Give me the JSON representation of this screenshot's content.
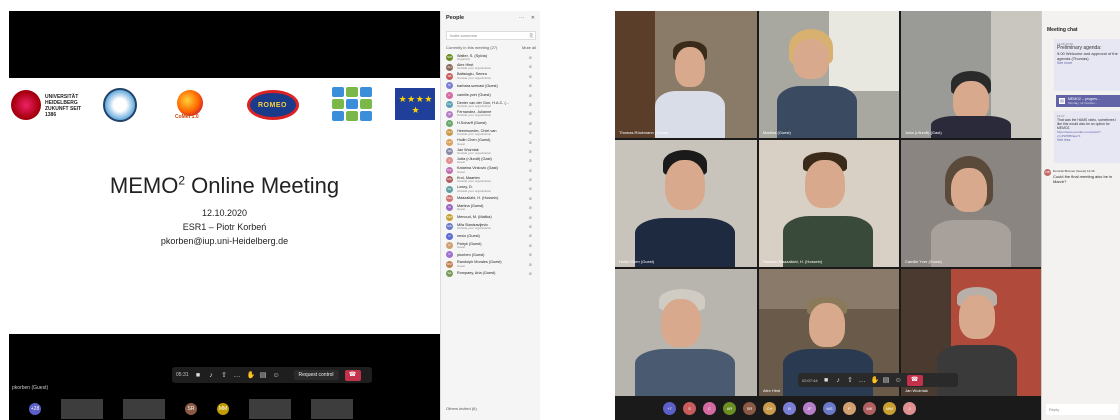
{
  "left": {
    "slide": {
      "uni_text": "UNIVERSITÄT HEIDELBERG ZUKUNFT SEIT 1386",
      "comet_text": "CoMet 1.0",
      "romeo_text": "ROMEO",
      "eu_stars": "★ ★ ★ ★ ★",
      "title_main": "MEMO",
      "title_sup": "2",
      "title_rest": " Online Meeting",
      "date": "12.10.2020",
      "presenter": "ESR1 – Piotr Korbeń",
      "email": "pkorben@iup.uni-Heidelberg.de"
    },
    "call": {
      "time": "05:31",
      "request_control": "Request control",
      "hangup_icon": "phone-hangup-icon"
    },
    "presenter_name": "pkorben (Guest)",
    "thumbs": [
      {
        "initials": "+28",
        "color": "#5b5fc7"
      },
      {
        "initials": "SR",
        "color": "#8a5a44"
      },
      {
        "initials": "MM",
        "color": "#c19c00"
      }
    ],
    "people": {
      "title": "People",
      "more": "···",
      "close": "✕",
      "invite_placeholder": "Invite someone",
      "section": "Currently in this meeting (27)",
      "mute_all": "Mute all",
      "others_invited": "Others invited (6)",
      "items": [
        {
          "initials": "SW",
          "name": "Walter, S. (Sylvia)",
          "sub": "Organizer",
          "color": "#6b8e23"
        },
        {
          "initials": "AH",
          "name": "Alex Hirst",
          "sub": "Outside your organization",
          "color": "#8b6c5c"
        },
        {
          "initials": "SB",
          "name": "Baltsioglu, Semra",
          "sub": "Outside your organization",
          "color": "#c85c5c"
        },
        {
          "initials": "B",
          "name": "barbara.szenasi (Guest)",
          "sub": "",
          "color": "#7a7fd6"
        },
        {
          "initials": "C",
          "name": "camille.yver (Guest)",
          "sub": "",
          "color": "#d46aa0"
        },
        {
          "initials": "DV",
          "name": "Denier van der Gon, H.A.C. (...",
          "sub": "Outside your organization",
          "color": "#5a9fb5"
        },
        {
          "initials": "JF",
          "name": "Fernandez, Julianne",
          "sub": "Outside your organization",
          "color": "#b57ec9"
        },
        {
          "initials": "H",
          "name": "H.Scharff (Guest)",
          "sub": "",
          "color": "#6ba86b"
        },
        {
          "initials": "CH",
          "name": "Heemsoeder, Chiel van",
          "sub": "Outside your organization",
          "color": "#c99a4a"
        },
        {
          "initials": "HC",
          "name": "Huilin Chen (Guest)",
          "sub": "Guest",
          "color": "#d9a15a"
        },
        {
          "initials": "JW",
          "name": "Jan Woźniak",
          "sub": "Outside your organization",
          "color": "#8a8aa8"
        },
        {
          "initials": "J",
          "name": "Jutta (rJlundt) (Gast)",
          "sub": "Guest",
          "color": "#e09090"
        },
        {
          "initials": "KV",
          "name": "Katarina Vinkovic (Gast)",
          "sub": "Guest",
          "color": "#c070b0"
        },
        {
          "initials": "MK",
          "name": "Krol, Maarten",
          "sub": "Outside your organization",
          "color": "#b06060"
        },
        {
          "initials": "DL",
          "name": "Lowry, D.",
          "sub": "Outside your organization",
          "color": "#60a0a0"
        },
        {
          "initials": "MH",
          "name": "Maazallahi, H. (Hossein)",
          "sub": "",
          "color": "#d07070"
        },
        {
          "initials": "M",
          "name": "Martina (Guest)",
          "sub": "Guest",
          "color": "#9a6ac0"
        },
        {
          "initials": "MM",
          "name": "Menoud, M. (Malika)",
          "sub": "",
          "color": "#c9a030"
        },
        {
          "initials": "MS",
          "name": "Mila Stanisavljevic",
          "sub": "Outside your organization",
          "color": "#6a7ac9"
        },
        {
          "initials": "N",
          "name": "nesio (Guest)",
          "sub": "",
          "color": "#5a6ad0"
        },
        {
          "initials": "P",
          "name": "Patryk (Guest)",
          "sub": "Guest",
          "color": "#d0a070"
        },
        {
          "initials": "P",
          "name": "pkorben (Guest)",
          "sub": "",
          "color": "#a070d0"
        },
        {
          "initials": "RM",
          "name": "Randolph Morales (Guest)",
          "sub": "Guest",
          "color": "#c08050"
        },
        {
          "initials": "SA",
          "name": "Rompaey, Aria (Guest)",
          "sub": "",
          "color": "#7a9a5a"
        }
      ]
    }
  },
  "right": {
    "tiles": [
      {
        "name": "Thomas Röckmann (Guest)"
      },
      {
        "name": "Martina (Guest)"
      },
      {
        "name": "Jutta (rJlundt) (Gast)"
      },
      {
        "name": "Huilin Chen (Guest)"
      },
      {
        "name": "Hossein Maazallahi, H. (Hossein)"
      },
      {
        "name": "Camille Yver (Guest)"
      },
      {
        "name": ""
      },
      {
        "name": "Alex Hirst"
      },
      {
        "name": "Jan Woźniak"
      }
    ],
    "call": {
      "time": "02:07:44"
    },
    "strip": [
      {
        "initials": "+7",
        "color": "#5b5fc7"
      },
      {
        "initials": "S",
        "color": "#c85c5c"
      },
      {
        "initials": "C",
        "color": "#d46aa0"
      },
      {
        "initials": "AR",
        "color": "#6b8e23"
      },
      {
        "initials": "SR",
        "color": "#8a5a44"
      },
      {
        "initials": "CH",
        "color": "#c99a4a"
      },
      {
        "initials": "B",
        "color": "#7a7fd6"
      },
      {
        "initials": "JF",
        "color": "#b57ec9"
      },
      {
        "initials": "MS",
        "color": "#6a7ac9"
      },
      {
        "initials": "P",
        "color": "#d0a070"
      },
      {
        "initials": "MK",
        "color": "#b06060"
      },
      {
        "initials": "MM",
        "color": "#c9a030"
      },
      {
        "initials": "J",
        "color": "#e09090"
      }
    ],
    "chat": {
      "title": "Meeting chat",
      "msg1_time": "14.09 13:40",
      "msg1_text": "Preliminary agenda:",
      "msg1_body": "9:00 Welcome and approval of the agenda (Thomas)",
      "msg1_more": "See more",
      "file_name": "MEMO2 -- progres...",
      "file_sub": "Monday, 12 October...",
      "msg2_time": "12:17",
      "msg2_text": "That was the HAMS video, sometimes I like this would also be an option for MEMO2.",
      "msg2_link": "https://www.youtube.com/watch?v=yPWf0B0ajaY4",
      "msg2_more": "See less",
      "dm_initials": "DB",
      "dm_meta": "Dominik Brunner (Guest)  12:46",
      "dm_text": "Could the final meeting also be in March?",
      "reply_placeholder": "Reply"
    }
  }
}
